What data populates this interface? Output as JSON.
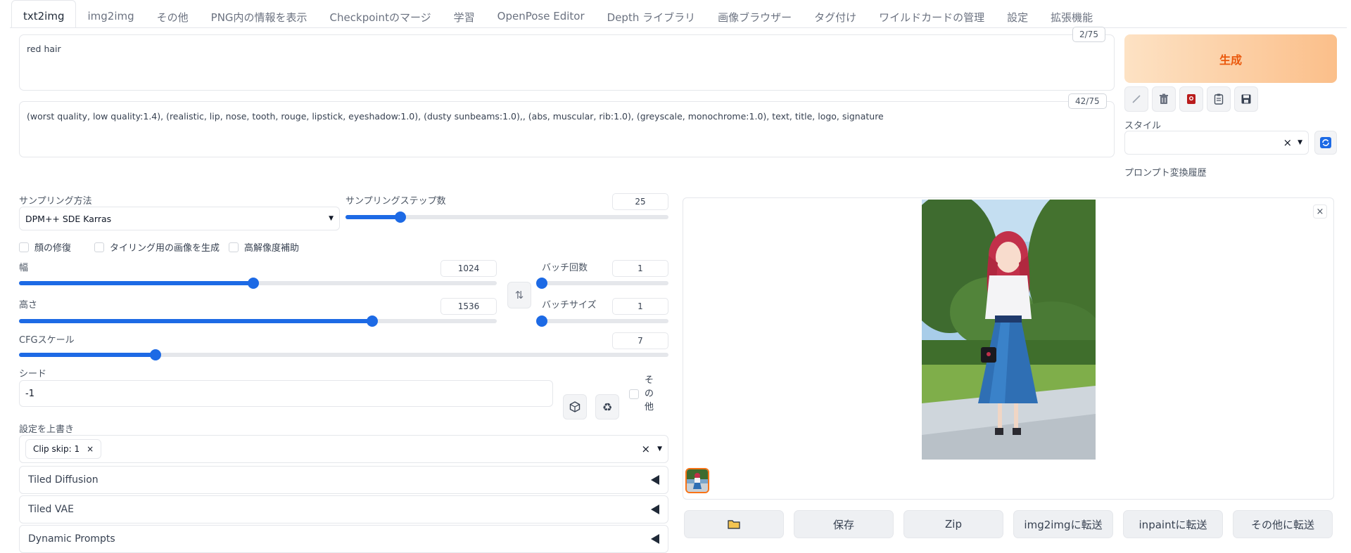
{
  "tabs": [
    "txt2img",
    "img2img",
    "その他",
    "PNG内の情報を表示",
    "Checkpointのマージ",
    "学習",
    "OpenPose Editor",
    "Depth ライブラリ",
    "画像ブラウザー",
    "タグ付け",
    "ワイルドカードの管理",
    "設定",
    "拡張機能"
  ],
  "prompt": {
    "text": "red hair",
    "counter": "2/75"
  },
  "negative_prompt": {
    "text": "(worst quality, low quality:1.4), (realistic, lip, nose, tooth, rouge, lipstick, eyeshadow:1.0), (dusty sunbeams:1.0),, (abs, muscular, rib:1.0), (greyscale, monochrome:1.0), text, title, logo, signature",
    "counter": "42/75"
  },
  "generate_label": "生成",
  "style": {
    "label": "スタイル",
    "value": "",
    "clear": "×"
  },
  "prompt_history_label": "プロンプト変換履歴",
  "sampling": {
    "method_label": "サンプリング方法",
    "method_value": "DPM++ SDE Karras",
    "steps_label": "サンプリングステップ数",
    "steps_value": "25",
    "steps_fraction": 0.17
  },
  "options": {
    "restore_faces": "顔の修復",
    "tiling": "タイリング用の画像を生成",
    "hires": "高解像度補助"
  },
  "width": {
    "label": "幅",
    "value": "1024",
    "fraction": 0.49
  },
  "height": {
    "label": "高さ",
    "value": "1536",
    "fraction": 0.74
  },
  "batch_count": {
    "label": "バッチ回数",
    "value": "1",
    "fraction": 0.0
  },
  "batch_size": {
    "label": "バッチサイズ",
    "value": "1",
    "fraction": 0.0
  },
  "cfg": {
    "label": "CFGスケール",
    "value": "7",
    "fraction": 0.21
  },
  "seed": {
    "label": "シード",
    "value": "-1",
    "extra_label": "その他"
  },
  "override": {
    "label": "設定を上書き",
    "chip": "Clip skip: 1",
    "chip_close": "×",
    "clear": "×"
  },
  "accordions": [
    "Tiled Diffusion",
    "Tiled VAE",
    "Dynamic Prompts"
  ],
  "output_buttons": {
    "folder_icon": "folder-icon",
    "save": "保存",
    "zip": "Zip",
    "to_img2img": "img2imgに転送",
    "to_inpaint": "inpaintに転送",
    "to_extras": "その他に転送"
  },
  "colors": {
    "accent": "#1d6ae5",
    "generate_text": "#ea580c",
    "thumb_border": "#f97316"
  }
}
